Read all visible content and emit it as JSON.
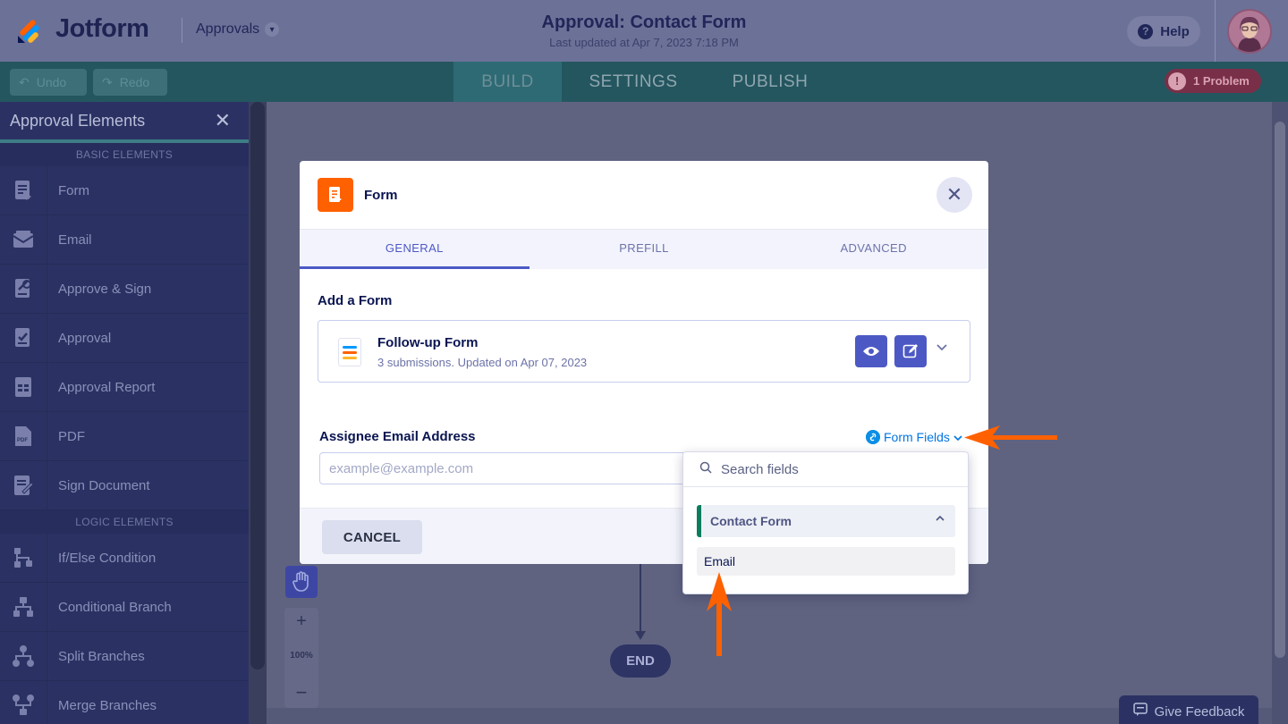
{
  "header": {
    "logo_text": "Jotform",
    "approvals_label": "Approvals",
    "title": "Approval: Contact Form",
    "subtitle": "Last updated at Apr 7, 2023 7:18 PM",
    "help_label": "Help"
  },
  "navbar": {
    "undo_label": "Undo",
    "redo_label": "Redo",
    "tabs": [
      "BUILD",
      "SETTINGS",
      "PUBLISH"
    ],
    "active_tab": "BUILD",
    "problem_label": "1 Problem"
  },
  "sidebar": {
    "title": "Approval Elements",
    "basic_section": "BASIC ELEMENTS",
    "basic_items": [
      "Form",
      "Email",
      "Approve & Sign",
      "Approval",
      "Approval Report",
      "PDF",
      "Sign Document"
    ],
    "logic_section": "LOGIC ELEMENTS",
    "logic_items": [
      "If/Else Condition",
      "Conditional Branch",
      "Split Branches",
      "Merge Branches"
    ]
  },
  "canvas": {
    "zoom_plus": "+",
    "zoom_level": "100%",
    "zoom_minus": "−",
    "end_label": "END",
    "feedback_label": "Give Feedback"
  },
  "modal": {
    "title": "Form",
    "tabs": [
      "GENERAL",
      "PREFILL",
      "ADVANCED"
    ],
    "active_tab": "GENERAL",
    "add_form_label": "Add a Form",
    "form_card": {
      "title": "Follow-up Form",
      "subtitle": "3 submissions. Updated on Apr 07, 2023"
    },
    "assignee_label": "Assignee Email Address",
    "form_fields_label": "Form Fields",
    "email_placeholder": "example@example.com",
    "cancel_label": "CANCEL"
  },
  "dropdown": {
    "search_placeholder": "Search fields",
    "group_label": "Contact Form",
    "items": [
      "Email"
    ]
  },
  "colors": {
    "accent": "#4c59c4",
    "brand_orange": "#ff6100",
    "annotation_arrow": "#ff6100",
    "group_marker": "#0b7d5f"
  }
}
